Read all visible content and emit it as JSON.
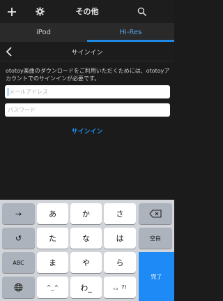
{
  "header": {
    "title": "その他",
    "icons": {
      "left1": "plus-icon",
      "left2": "gear-icon",
      "right": "search-icon"
    }
  },
  "tabs": [
    {
      "label": "iPod",
      "active": false
    },
    {
      "label": "Hi-Res",
      "active": true
    }
  ],
  "signin": {
    "title": "サインイン",
    "notice": "ototoy楽曲のダウンロードをご利用いただくためには、ototoyアカウントでのサインインが必要です。",
    "email_placeholder": "メールアドレス",
    "password_placeholder": "パスワード",
    "button_label": "サインイン"
  },
  "keyboard": {
    "row1": [
      "→",
      "あ",
      "か",
      "さ",
      "⌫"
    ],
    "row2": [
      "↺",
      "た",
      "な",
      "は",
      "空白"
    ],
    "row3": [
      "ABC",
      "ま",
      "や",
      "ら"
    ],
    "row4": [
      "🌐",
      "^_^",
      "わ_",
      "、。?!"
    ],
    "done_label": "完了"
  },
  "colors": {
    "accent": "#1f8ae6",
    "done_key": "#1d8af5",
    "background": "#1b1b1b",
    "keyboard_bg": "#d1d4d9"
  }
}
